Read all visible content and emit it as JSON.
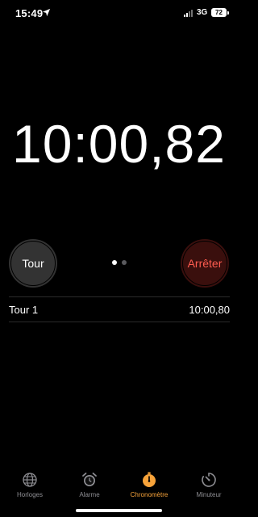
{
  "status_bar": {
    "time": "15:49",
    "network": "3G",
    "battery": "72"
  },
  "stopwatch": {
    "elapsed": "10:00,82"
  },
  "buttons": {
    "lap_label": "Tour",
    "stop_label": "Arrêter"
  },
  "page_indicator": {
    "count": 2,
    "active_index": 0
  },
  "laps": [
    {
      "name": "Tour 1",
      "time": "10:00,80"
    }
  ],
  "tabs": [
    {
      "label": "Horloges",
      "icon": "globe-icon",
      "active": false
    },
    {
      "label": "Alarme",
      "icon": "alarm-clock-icon",
      "active": false
    },
    {
      "label": "Chronomètre",
      "icon": "stopwatch-icon",
      "active": true
    },
    {
      "label": "Minuteur",
      "icon": "timer-icon",
      "active": false
    }
  ],
  "colors": {
    "accent": "#f7a33a",
    "stop_text": "#ff5c50",
    "stop_bg": "#3a0f0d",
    "lap_bg": "#333333"
  }
}
